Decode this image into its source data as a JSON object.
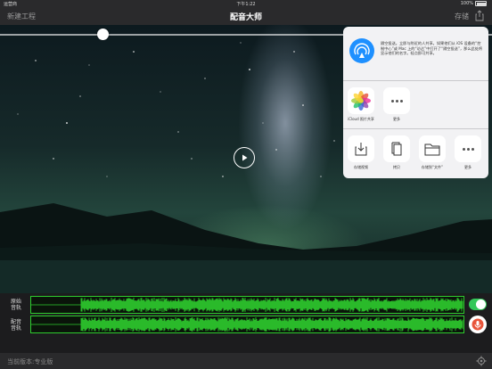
{
  "status": {
    "carrier": "运营商",
    "time": "下午1:22",
    "battery": "100%"
  },
  "nav": {
    "new_project": "新建工程",
    "title": "配音大师",
    "save": "存储"
  },
  "player": {
    "progress": 0.21
  },
  "share": {
    "airdrop_text": "隔空投送。立即与附近的人共享。如果他们从 iOS 设备的“控制中心”或 Mac 上的“访达”中打开了“隔空投送”，那么此处将显示他们的名字。轻点即可共享。",
    "apps": [
      {
        "label": "iCloud 照片共享",
        "icon": "photos-icon"
      },
      {
        "label": "更多",
        "icon": "more-icon"
      }
    ],
    "actions": [
      {
        "label": "存储视频",
        "icon": "save-video-icon"
      },
      {
        "label": "拷贝",
        "icon": "copy-icon"
      },
      {
        "label": "存储到“文件”",
        "icon": "folder-icon"
      },
      {
        "label": "更多",
        "icon": "more-icon"
      }
    ]
  },
  "tracks": {
    "original_label": "原始\n音轨",
    "dub_label": "配音\n音轨",
    "original_enabled": true,
    "wave_color": "#2ecc2e"
  },
  "footer": {
    "version": "当前版本:专业版"
  }
}
